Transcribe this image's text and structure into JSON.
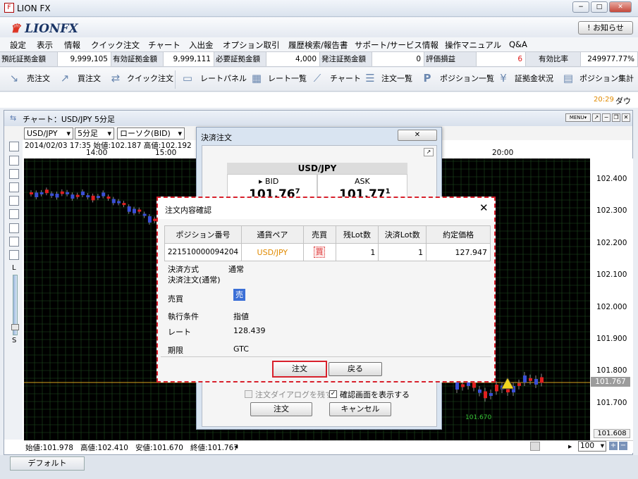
{
  "window": {
    "title": "LION FX"
  },
  "logo": "LIONFX",
  "notice_button": "! お知らせ",
  "menu": [
    "設定",
    "表示",
    "情報",
    "クイック注文",
    "チャート",
    "入出金",
    "オプション取引",
    "履歴検索/報告書",
    "サポート/サービス情報",
    "操作マニュアル",
    "Q&A"
  ],
  "account": [
    {
      "label": "預託証拠金額",
      "value": "9,999,105"
    },
    {
      "label": "有効証拠金額",
      "value": "9,999,111"
    },
    {
      "label": "必要証拠金額",
      "value": "4,000"
    },
    {
      "label": "発注証拠金額",
      "value": "0"
    },
    {
      "label": "評価損益",
      "value": "6"
    },
    {
      "label": "有効比率",
      "value": "249977.77%"
    }
  ],
  "toolbar": [
    "売注文",
    "買注文",
    "クイック注文",
    "レートパネル",
    "レート一覧",
    "チャート",
    "注文一覧",
    "ポジション一覧",
    "証拠金状況",
    "ポジション集計"
  ],
  "news": {
    "time": "20:29",
    "text": "ダウ"
  },
  "chart": {
    "title": "チャート：USD/JPY 5分足",
    "pair": "USD/JPY",
    "interval": "5分足",
    "type": "ローソク(BID)",
    "info": "2014/02/03 17:35 始値:102.187 高値:102.192",
    "times": [
      "14:00",
      "15:00",
      "20:00"
    ],
    "y_ticks": [
      "102.400",
      "102.300",
      "102.200",
      "102.100",
      "102.000",
      "101.900",
      "101.800",
      "101.700"
    ],
    "current_price": "101.767",
    "bottom_price": "101.608",
    "low_marker": "101.670",
    "summary": {
      "open": "始値:101.978",
      "high": "高値:102.410",
      "low": "安値:101.670",
      "close": "終値:101.767"
    },
    "zoom": "100",
    "menu_label": "MENU",
    "scale_top": "L",
    "scale_bottom": "S"
  },
  "settlement": {
    "title": "決済注文",
    "pair": "USD/JPY",
    "bid_label": "BID",
    "ask_label": "ASK",
    "bid_price": "101.76",
    "bid_pip": "7",
    "ask_price": "101.77",
    "ask_pip": "1",
    "skip_label": "注文ダイアログを残す",
    "confirm_label": "確認画面を表示する",
    "order_btn": "注文",
    "cancel_btn": "キャンセル"
  },
  "confirm": {
    "title": "注文内容確認",
    "headers": [
      "ポジション番号",
      "通貨ペア",
      "売買",
      "残Lot数",
      "決済Lot数",
      "約定価格"
    ],
    "row": {
      "position": "221510000094204",
      "pair": "USD/JPY",
      "side": "買",
      "remaining": "1",
      "settle": "1",
      "price": "127.947"
    },
    "fields": {
      "method_label": "決済方式",
      "method_value": "通常",
      "settle_type": "決済注文(通常)",
      "side_label": "売買",
      "side_value": "売",
      "cond_label": "執行条件",
      "cond_value": "指値",
      "rate_label": "レート",
      "rate_value": "128.439",
      "expiry_label": "期限",
      "expiry_value": "GTC"
    },
    "order_btn": "注文",
    "back_btn": "戻る"
  },
  "tabs": {
    "default": "デフォルト"
  },
  "colors": {
    "up": "#e02020",
    "down": "#3a4fd6",
    "grid": "#1f4d1f",
    "accent": "#d8212c"
  }
}
